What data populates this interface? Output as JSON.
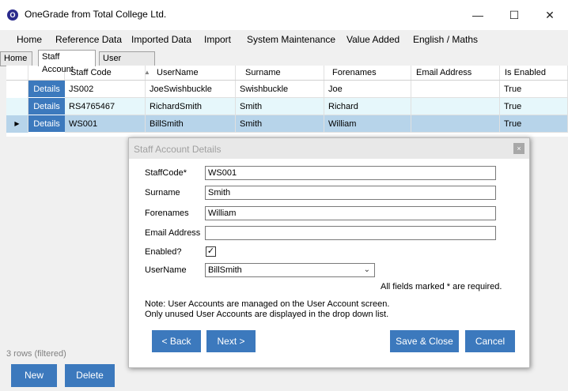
{
  "window": {
    "app_icon": "onegrade-logo-icon",
    "icon_letter": "O",
    "title": "OneGrade from Total College Ltd.",
    "minimize_glyph": "—",
    "maximize_glyph": "☐",
    "close_glyph": "✕"
  },
  "menu": [
    "Home",
    "Reference Data",
    "Imported Data",
    "Import",
    "System Maintenance",
    "Value Added",
    "English / Maths"
  ],
  "tabs": [
    "Home",
    "Staff Account",
    "User Account"
  ],
  "grid": {
    "columns": [
      "Staff Code",
      "UserName",
      "Surname",
      "Forenames",
      "Email Address",
      "Is Enabled"
    ],
    "sort_glyph": "▲",
    "details_label": "Details",
    "row_indicator": "▶",
    "rows": [
      {
        "staff_code": "JS002",
        "username": "JoeSwishbuckle",
        "surname": "Swishbuckle",
        "forenames": "Joe",
        "email": "",
        "enabled": "True"
      },
      {
        "staff_code": "RS4765467",
        "username": "RichardSmith",
        "surname": "Smith",
        "forenames": "Richard",
        "email": "",
        "enabled": "True"
      },
      {
        "staff_code": "WS001",
        "username": "BillSmith",
        "surname": "Smith",
        "forenames": "William",
        "email": "",
        "enabled": "True"
      }
    ],
    "row_colors": [
      "#ffffff",
      "#e6f7fb",
      "#b7d4ea"
    ]
  },
  "status": {
    "row_count": "3 rows (filtered)"
  },
  "footer": {
    "new_label": "New",
    "delete_label": "Delete"
  },
  "dialog": {
    "title": "Staff Account Details",
    "close_glyph": "×",
    "labels": {
      "staff_code": "StaffCode*",
      "surname": "Surname",
      "forenames": "Forenames",
      "email": "Email Address",
      "enabled": "Enabled?",
      "username": "UserName"
    },
    "values": {
      "staff_code": "WS001",
      "surname": "Smith",
      "forenames": "William",
      "email": "",
      "enabled": true,
      "username": "BillSmith"
    },
    "check_glyph": "✓",
    "dropdown_glyph": "⌄",
    "required_note": "All fields marked * are required.",
    "note_line1": "Note: User Accounts are managed on the User Account screen.",
    "note_line2": "Only unused User Accounts are displayed in the drop down list.",
    "buttons": {
      "back": "< Back",
      "next": "Next >",
      "save_close": "Save & Close",
      "cancel": "Cancel"
    }
  },
  "colors": {
    "accent": "#3c79bd",
    "selected_row": "#b7d4ea",
    "alt_row": "#e6f7fb"
  }
}
